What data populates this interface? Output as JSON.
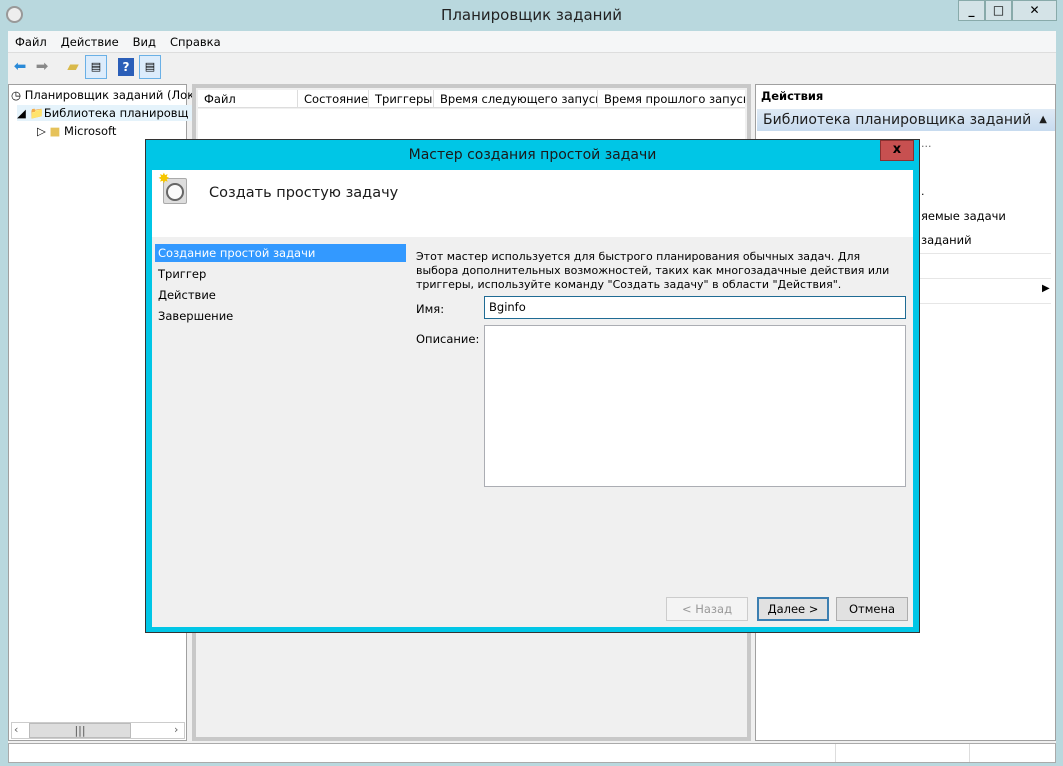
{
  "window": {
    "title": "Планировщик заданий"
  },
  "menu": [
    "Файл",
    "Действие",
    "Вид",
    "Справка"
  ],
  "tree": {
    "root": "Планировщик заданий (Лок",
    "library": "Библиотека планировщ",
    "child": "Microsoft"
  },
  "columns": [
    "Файл",
    "Состояние",
    "Триггеры",
    "Время следующего запуска",
    "Время прошлого запуска"
  ],
  "actions": {
    "header": "Действия",
    "section": "Библиотека планировщика заданий",
    "items": [
      "...",
      ".",
      "яемые задачи",
      "заданий"
    ]
  },
  "dialog": {
    "title": "Мастер создания простой задачи",
    "heading": "Создать простую задачу",
    "steps": [
      "Создание простой задачи",
      "Триггер",
      "Действие",
      "Завершение"
    ],
    "description": "Этот мастер используется для быстрого планирования обычных задач.  Для выбора дополнительных возможностей, таких как многозадачные действия или триггеры, используйте команду \"Создать задачу\" в области \"Действия\".",
    "name_label": "Имя:",
    "name_value": "Bginfo",
    "desc_label": "Описание:",
    "desc_value": "",
    "back": "< Назад",
    "next": "Далее >",
    "cancel": "Отмена",
    "close": "x"
  },
  "colors": {
    "dialog_border": "#00c6e6",
    "selection": "#3399ff",
    "close": "#c75050"
  }
}
